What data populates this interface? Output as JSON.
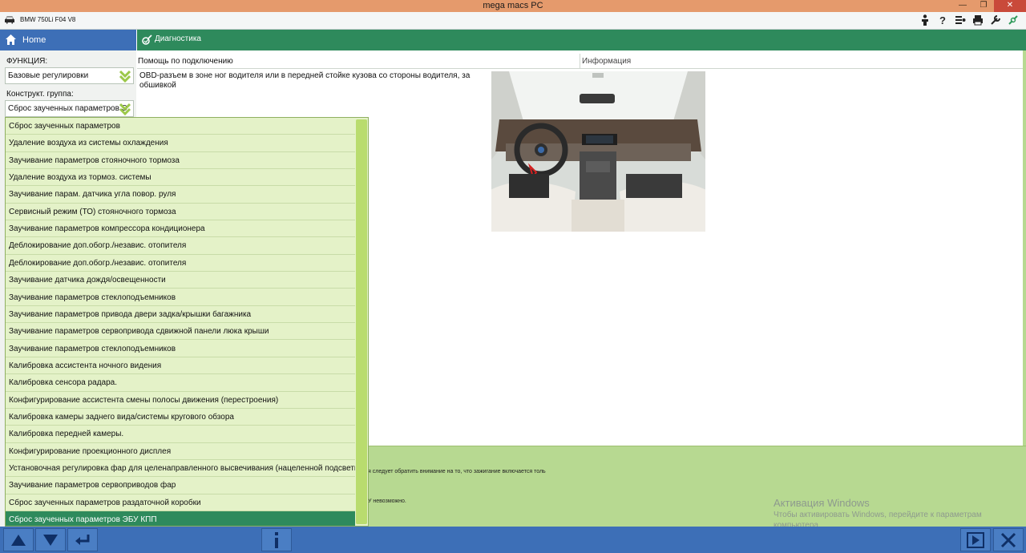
{
  "window": {
    "title": "mega macs PC",
    "controls": [
      "—",
      "❐",
      "✕"
    ]
  },
  "vehicle": {
    "name": "BMW 750Li F04 V8"
  },
  "nav": {
    "home_label": "Home",
    "diag_label": "Диагностика"
  },
  "left": {
    "function_label": "ФУНКЦИЯ:",
    "function_value": "Базовые регулировки",
    "group_label": "Конструкт. группа:",
    "group_value": "Сброс заученных параметров Э"
  },
  "panes": {
    "help_title": "Помощь по подключению",
    "info_title": "Информация",
    "help_text": "OBD-разъем в зоне ног водителя или в передней стойке кузова со стороны водителя, за обшивкой"
  },
  "lower": {
    "line1": "я следует обратить внимание на то, что зажигание включается толь",
    "line2": "У невозможно."
  },
  "watermark": {
    "title": "Активация Windows",
    "text": "Чтобы активировать Windows, перейдите к параметрам компьютера."
  },
  "dropdown": {
    "items": [
      "Сброс заученных параметров",
      "Удаление воздуха из системы охлаждения",
      "Заучивание параметров стояночного тормоза",
      "Удаление воздуха из тормоз. системы",
      "Заучивание парам. датчика угла повор. руля",
      "Сервисный режим (ТО) стояночного тормоза",
      "Заучивание параметров компрессора кондиционера",
      "Деблокирование доп.обогр./независ. отопителя",
      "Деблокирование доп.обогр./независ. отопителя",
      "Заучивание датчика дождя/освещенности",
      "Заучивание параметров стеклоподъемников",
      "Заучивание параметров привода двери задка/крышки багажника",
      "Заучивание параметров сервопривода сдвижной панели люка крыши",
      "Заучивание параметров стеклоподъемников",
      "Калибровка ассистента ночного видения",
      "Калибровка сенсора радара.",
      "Конфигурирование ассистента смены полосы движения (перестроения)",
      "Калибровка камеры заднего вида/системы кругового обзора",
      "Калибровка передней камеры.",
      "Конфигурирование проекционного дисплея",
      "Установочная регулировка фар для целенаправленного высвечивания (нацеленной подсветки)",
      "Заучивание параметров сервоприводов фар",
      "Сброс заученных параметров раздаточной коробки",
      "Сброс заученных параметров ЭБУ КПП"
    ],
    "selected_index": 23
  },
  "icons": {
    "toolbar": [
      "person-icon",
      "help-icon",
      "settings-list-icon",
      "print-icon",
      "tools-icon",
      "connection-icon"
    ],
    "bottom": [
      "arrow-up-icon",
      "arrow-down-icon",
      "enter-icon",
      "info-icon",
      "play-icon",
      "close-icon"
    ]
  },
  "colors": {
    "accent_green": "#2e8a5c",
    "accent_blue": "#3d6fb7",
    "light_green": "#b7d991",
    "list_bg": "#e4f2c8"
  }
}
